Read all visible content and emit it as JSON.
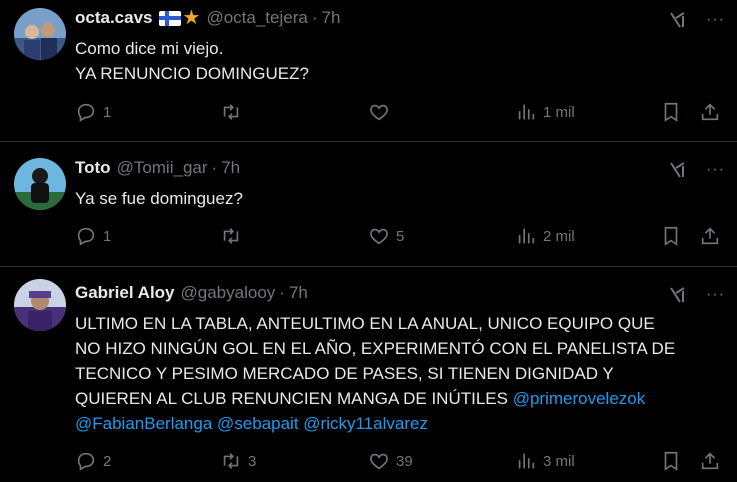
{
  "tweets": [
    {
      "name": "octa.cavs",
      "handle": "@octa_tejera",
      "time": "7h",
      "text_lines": [
        "Como dice mi viejo.",
        "YA RENUNCIO DOMINGUEZ?"
      ],
      "replies": "1",
      "retweets": "",
      "likes": "",
      "views": "1 mil"
    },
    {
      "name": "Toto",
      "handle": "@Tomii_gar",
      "time": "7h",
      "text_lines": [
        "Ya se fue dominguez?"
      ],
      "replies": "1",
      "retweets": "",
      "likes": "5",
      "views": "2 mil"
    },
    {
      "name": "Gabriel Aloy",
      "handle": "@gabyalooy",
      "time": "7h",
      "text_lines": [
        "ULTIMO EN LA TABLA, ANTEULTIMO EN LA ANUAL, UNICO EQUIPO QUE",
        "NO HIZO NINGÚN GOL EN EL AÑO, EXPERIMENTÓ CON EL PANELISTA DE",
        "TECNICO Y PESIMO MERCADO DE PASES, SI TIENEN DIGNIDAD Y",
        "QUIEREN AL CLUB RENUNCIEN MANGA DE INÚTILES"
      ],
      "mentions": [
        "@primerovelezok",
        "@FabianBerlanga",
        "@sebapait",
        "@ricky11alvarez"
      ],
      "replies": "2",
      "retweets": "3",
      "likes": "39",
      "views": "3 mil"
    }
  ],
  "colors": {
    "background": "#000000",
    "text": "#e7e9ea",
    "muted": "#71767b",
    "link": "#1d9bf0",
    "divider": "#2f3336"
  },
  "icons": [
    "reply-icon",
    "retweet-icon",
    "like-icon",
    "views-icon",
    "bookmark-icon",
    "share-icon",
    "grok-icon",
    "more-icon",
    "finland-flag-icon",
    "star-icon"
  ]
}
